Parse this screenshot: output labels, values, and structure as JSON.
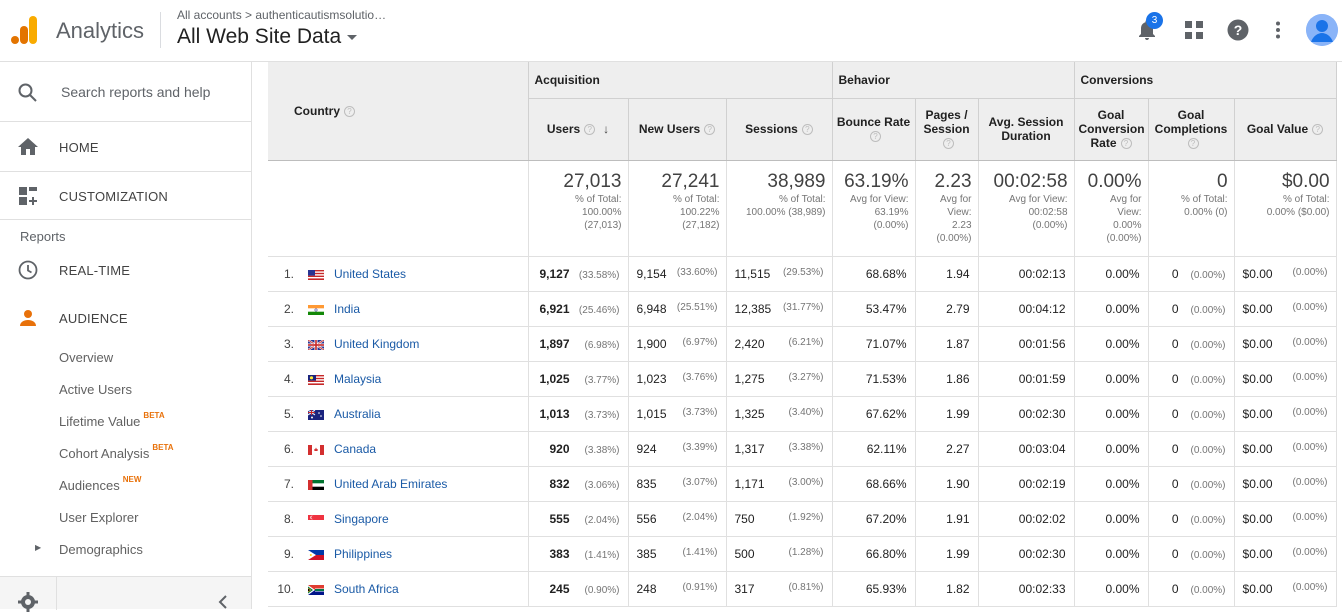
{
  "header": {
    "app_title": "Analytics",
    "breadcrumb": "All accounts  >  authenticautismsolutio…",
    "view_name": "All Web Site Data",
    "notification_count": "3",
    "brand_colors": {
      "logo_orange": "#f9ab00",
      "logo_dark": "#e37400",
      "accent": "#1a73e8"
    }
  },
  "sidebar": {
    "search_label": "Search reports and help",
    "home_label": "HOME",
    "customization_label": "CUSTOMIZATION",
    "reports_heading": "Reports",
    "realtime_label": "REAL-TIME",
    "audience_label": "AUDIENCE",
    "audience_items": [
      {
        "label": "Overview",
        "badge": ""
      },
      {
        "label": "Active Users",
        "badge": ""
      },
      {
        "label": "Lifetime Value",
        "badge": "BETA"
      },
      {
        "label": "Cohort Analysis",
        "badge": "BETA"
      },
      {
        "label": "Audiences",
        "badge": "NEW"
      },
      {
        "label": "User Explorer",
        "badge": ""
      },
      {
        "label": "Demographics",
        "badge": ""
      }
    ]
  },
  "table": {
    "groups": {
      "acquisition": "Acquisition",
      "behavior": "Behavior",
      "conversions": "Conversions"
    },
    "columns": {
      "country": "Country",
      "users": "Users",
      "new_users": "New Users",
      "sessions": "Sessions",
      "bounce_rate": "Bounce Rate",
      "pages_session": "Pages / Session",
      "avg_session": "Avg. Session Duration",
      "goal_conv_rate": "Goal Conversion Rate",
      "goal_completions": "Goal Completions",
      "goal_value": "Goal Value"
    },
    "totals": {
      "users": {
        "value": "27,013",
        "l1": "% of Total:",
        "l2": "100.00%",
        "l3": "(27,013)"
      },
      "new_users": {
        "value": "27,241",
        "l1": "% of Total:",
        "l2": "100.22%",
        "l3": "(27,182)"
      },
      "sessions": {
        "value": "38,989",
        "l1": "% of Total:",
        "l2": "100.00% (38,989)",
        "l3": ""
      },
      "bounce_rate": {
        "value": "63.19%",
        "l1": "Avg for View:",
        "l2": "63.19%",
        "l3": "(0.00%)"
      },
      "pages_session": {
        "value": "2.23",
        "l1": "Avg for",
        "l2": "View:",
        "l3": "2.23",
        "l4": "(0.00%)"
      },
      "avg_session": {
        "value": "00:02:58",
        "l1": "Avg for View:",
        "l2": "00:02:58",
        "l3": "(0.00%)"
      },
      "goal_conv_rate": {
        "value": "0.00%",
        "l1": "Avg for",
        "l2": "View:",
        "l3": "0.00%",
        "l4": "(0.00%)"
      },
      "goal_completions": {
        "value": "0",
        "l1": "% of Total:",
        "l2": "0.00% (0)",
        "l3": ""
      },
      "goal_value": {
        "value": "$0.00",
        "l1": "% of Total:",
        "l2": "0.00% ($0.00)",
        "l3": ""
      }
    },
    "rows": [
      {
        "rank": "1.",
        "country": "United States",
        "flag": "us",
        "users": "9,127",
        "users_pct": "(33.58%)",
        "new_users": "9,154",
        "new_users_pct": "(33.60%)",
        "sessions": "11,515",
        "sessions_pct": "(29.53%)",
        "bounce": "68.68%",
        "pages": "1.94",
        "duration": "00:02:13",
        "gcr": "0.00%",
        "gc": "0",
        "gc_pct": "(0.00%)",
        "gv": "$0.00",
        "gv_pct": "(0.00%)"
      },
      {
        "rank": "2.",
        "country": "India",
        "flag": "in",
        "users": "6,921",
        "users_pct": "(25.46%)",
        "new_users": "6,948",
        "new_users_pct": "(25.51%)",
        "sessions": "12,385",
        "sessions_pct": "(31.77%)",
        "bounce": "53.47%",
        "pages": "2.79",
        "duration": "00:04:12",
        "gcr": "0.00%",
        "gc": "0",
        "gc_pct": "(0.00%)",
        "gv": "$0.00",
        "gv_pct": "(0.00%)"
      },
      {
        "rank": "3.",
        "country": "United Kingdom",
        "flag": "gb",
        "users": "1,897",
        "users_pct": "(6.98%)",
        "new_users": "1,900",
        "new_users_pct": "(6.97%)",
        "sessions": "2,420",
        "sessions_pct": "(6.21%)",
        "bounce": "71.07%",
        "pages": "1.87",
        "duration": "00:01:56",
        "gcr": "0.00%",
        "gc": "0",
        "gc_pct": "(0.00%)",
        "gv": "$0.00",
        "gv_pct": "(0.00%)"
      },
      {
        "rank": "4.",
        "country": "Malaysia",
        "flag": "my",
        "users": "1,025",
        "users_pct": "(3.77%)",
        "new_users": "1,023",
        "new_users_pct": "(3.76%)",
        "sessions": "1,275",
        "sessions_pct": "(3.27%)",
        "bounce": "71.53%",
        "pages": "1.86",
        "duration": "00:01:59",
        "gcr": "0.00%",
        "gc": "0",
        "gc_pct": "(0.00%)",
        "gv": "$0.00",
        "gv_pct": "(0.00%)"
      },
      {
        "rank": "5.",
        "country": "Australia",
        "flag": "au",
        "users": "1,013",
        "users_pct": "(3.73%)",
        "new_users": "1,015",
        "new_users_pct": "(3.73%)",
        "sessions": "1,325",
        "sessions_pct": "(3.40%)",
        "bounce": "67.62%",
        "pages": "1.99",
        "duration": "00:02:30",
        "gcr": "0.00%",
        "gc": "0",
        "gc_pct": "(0.00%)",
        "gv": "$0.00",
        "gv_pct": "(0.00%)"
      },
      {
        "rank": "6.",
        "country": "Canada",
        "flag": "ca",
        "users": "920",
        "users_pct": "(3.38%)",
        "new_users": "924",
        "new_users_pct": "(3.39%)",
        "sessions": "1,317",
        "sessions_pct": "(3.38%)",
        "bounce": "62.11%",
        "pages": "2.27",
        "duration": "00:03:04",
        "gcr": "0.00%",
        "gc": "0",
        "gc_pct": "(0.00%)",
        "gv": "$0.00",
        "gv_pct": "(0.00%)"
      },
      {
        "rank": "7.",
        "country": "United Arab Emirates",
        "flag": "ae",
        "users": "832",
        "users_pct": "(3.06%)",
        "new_users": "835",
        "new_users_pct": "(3.07%)",
        "sessions": "1,171",
        "sessions_pct": "(3.00%)",
        "bounce": "68.66%",
        "pages": "1.90",
        "duration": "00:02:19",
        "gcr": "0.00%",
        "gc": "0",
        "gc_pct": "(0.00%)",
        "gv": "$0.00",
        "gv_pct": "(0.00%)"
      },
      {
        "rank": "8.",
        "country": "Singapore",
        "flag": "sg",
        "users": "555",
        "users_pct": "(2.04%)",
        "new_users": "556",
        "new_users_pct": "(2.04%)",
        "sessions": "750",
        "sessions_pct": "(1.92%)",
        "bounce": "67.20%",
        "pages": "1.91",
        "duration": "00:02:02",
        "gcr": "0.00%",
        "gc": "0",
        "gc_pct": "(0.00%)",
        "gv": "$0.00",
        "gv_pct": "(0.00%)"
      },
      {
        "rank": "9.",
        "country": "Philippines",
        "flag": "ph",
        "users": "383",
        "users_pct": "(1.41%)",
        "new_users": "385",
        "new_users_pct": "(1.41%)",
        "sessions": "500",
        "sessions_pct": "(1.28%)",
        "bounce": "66.80%",
        "pages": "1.99",
        "duration": "00:02:30",
        "gcr": "0.00%",
        "gc": "0",
        "gc_pct": "(0.00%)",
        "gv": "$0.00",
        "gv_pct": "(0.00%)"
      },
      {
        "rank": "10.",
        "country": "South Africa",
        "flag": "za",
        "users": "245",
        "users_pct": "(0.90%)",
        "new_users": "248",
        "new_users_pct": "(0.91%)",
        "sessions": "317",
        "sessions_pct": "(0.81%)",
        "bounce": "65.93%",
        "pages": "1.82",
        "duration": "00:02:33",
        "gcr": "0.00%",
        "gc": "0",
        "gc_pct": "(0.00%)",
        "gv": "$0.00",
        "gv_pct": "(0.00%)"
      }
    ]
  }
}
